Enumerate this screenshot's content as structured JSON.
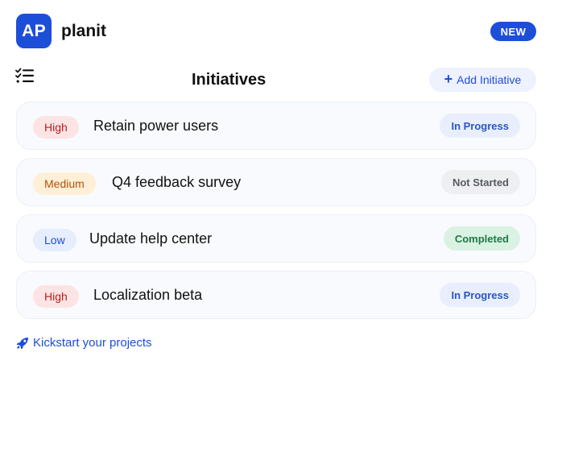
{
  "header": {
    "logo_initials": "AP",
    "app_name": "planit",
    "badge": "NEW"
  },
  "toolbar": {
    "title": "Initiatives",
    "add_label": "Add Initiative",
    "add_icon": "plus-icon",
    "list_icon": "checklist-icon"
  },
  "initiatives": [
    {
      "priority": "High",
      "title": "Retain power users",
      "status": "In Progress"
    },
    {
      "priority": "Medium",
      "title": "Q4 feedback survey",
      "status": "Not Started"
    },
    {
      "priority": "Low",
      "title": "Update help center",
      "status": "Completed"
    },
    {
      "priority": "High",
      "title": "Localization beta",
      "status": "In Progress"
    }
  ],
  "footer": {
    "link_label": "Kickstart your projects",
    "link_icon": "rocket-icon"
  },
  "colors": {
    "accent": "#1d4ed8",
    "priority_high": "#b91c1c",
    "priority_medium": "#b45309",
    "priority_low": "#1d4ed8",
    "status_in_progress": "#2a56c6",
    "status_not_started": "#555b65",
    "status_completed": "#1f7a47"
  }
}
